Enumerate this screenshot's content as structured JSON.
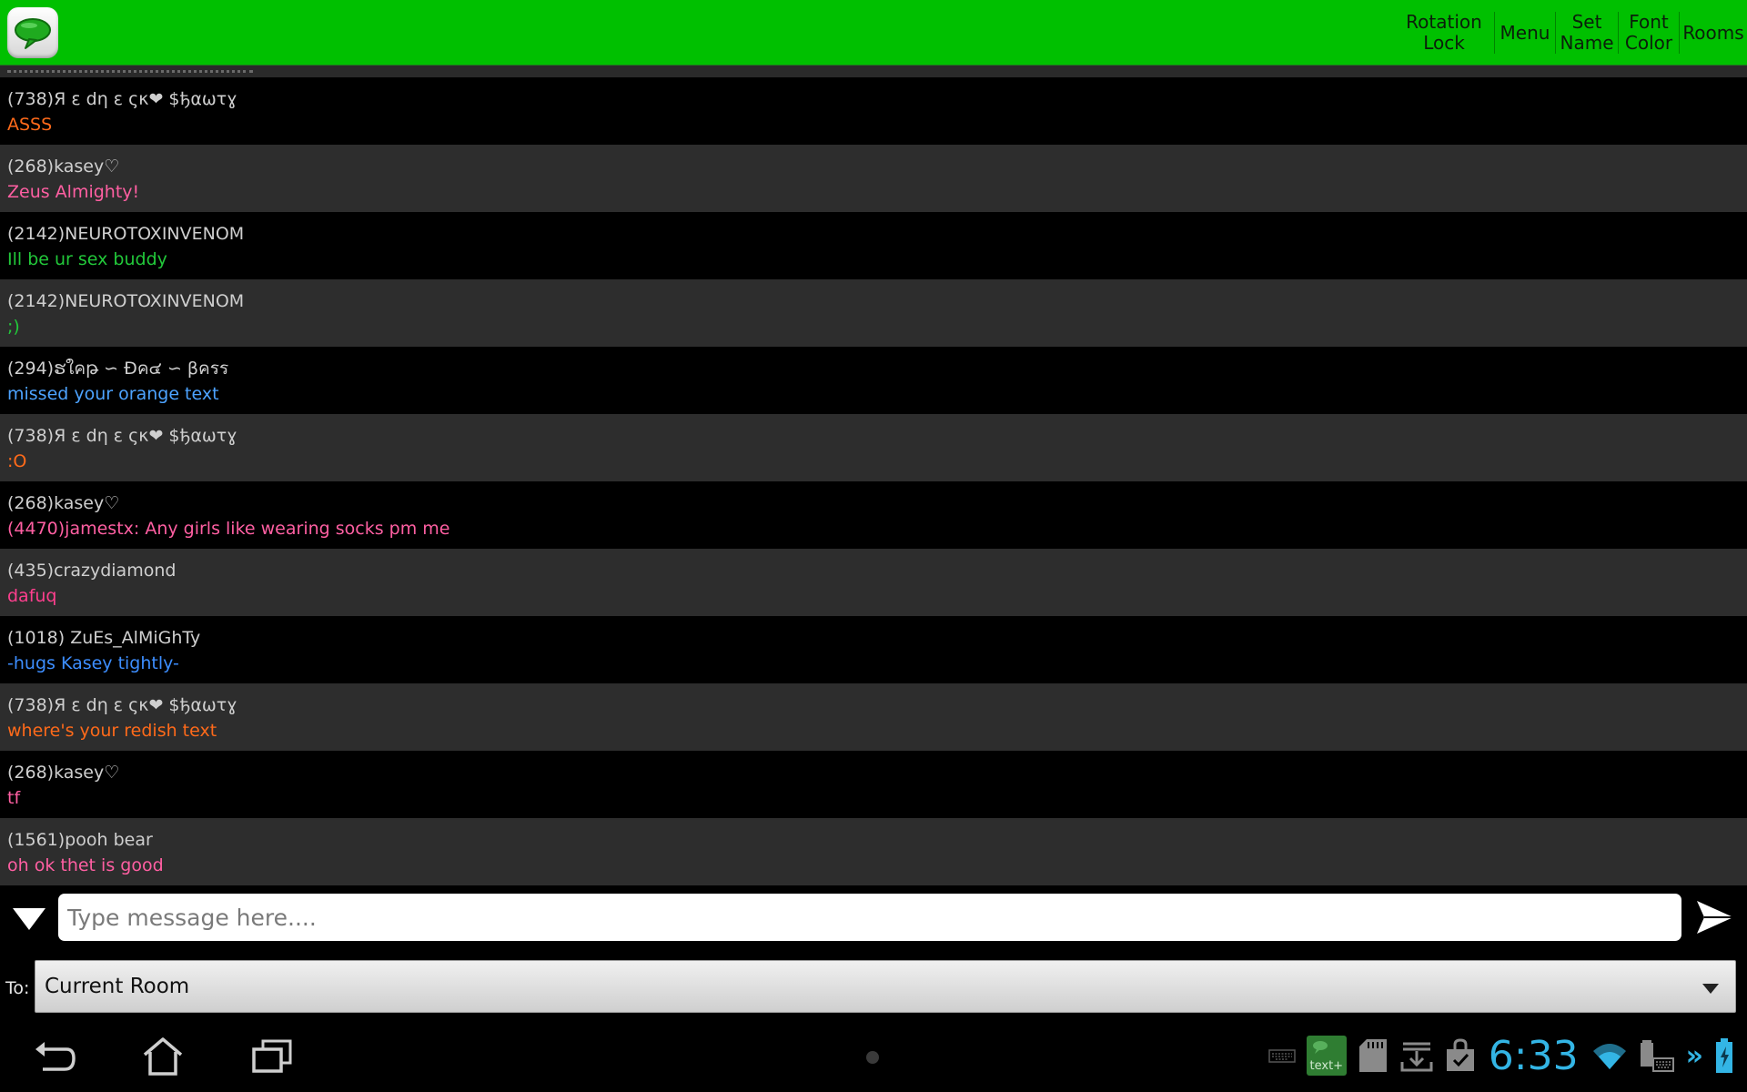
{
  "topbar": {
    "actions": {
      "rotation_lock": "Rotation\nLock",
      "menu": "Menu",
      "set_name": "Set\nName",
      "font_color": "Font\nColor",
      "rooms": "Rooms"
    }
  },
  "messages": [
    {
      "user": "(738)Я ε dη ε ςκ❤ $ђαωτɣ",
      "text": "ASSS",
      "color": "#ff6a1a"
    },
    {
      "user": "(268)kasey♡",
      "text": "Zeus Almighty!",
      "color": "#ff5fa2"
    },
    {
      "user": "(2142)NEUROTOXINVENOM",
      "text": "Ill be ur sex buddy",
      "color": "#22c83a"
    },
    {
      "user": "(2142)NEUROTOXINVENOM",
      "text": ";)",
      "color": "#22c83a"
    },
    {
      "user": "(294)ຮใคթ ∽ Đค๔ ∽ βครร",
      "text": "missed your orange text",
      "color": "#4da3ff"
    },
    {
      "user": "(738)Я ε dη ε ςκ❤ $ђαωτɣ",
      "text": ":O",
      "color": "#ff6a1a"
    },
    {
      "user": "(268)kasey♡",
      "text": "(4470)jamestx: Any girls like wearing socks pm me",
      "color": "#ff5fa2"
    },
    {
      "user": "(435)crazydiamond",
      "text": "dafuq",
      "color": "#ff3f8e"
    },
    {
      "user": "(1018) ZuEs_AlMiGhTy",
      "text": "-hugs Kasey tightly-",
      "color": "#3d8eff"
    },
    {
      "user": "(738)Я ε dη ε ςκ❤ $ђαωτɣ",
      "text": "where's your redish text",
      "color": "#ff6a1a"
    },
    {
      "user": "(268)kasey♡",
      "text": "tf",
      "color": "#ff5fa2"
    },
    {
      "user": "(1561)pooh bear",
      "text": "oh ok thet is good",
      "color": "#ff5fa2"
    }
  ],
  "input": {
    "placeholder": "Type message here...."
  },
  "recipient": {
    "label": "To:",
    "selected": "Current Room"
  },
  "statusbar": {
    "time": "6:33",
    "textplus_label": "text+"
  },
  "icons": {
    "app": "chat-bubble-icon",
    "collapse": "triangle-down-icon",
    "send": "send-arrow-icon",
    "dropdown": "chevron-down-icon",
    "back": "back-icon",
    "home": "home-icon",
    "recent": "recent-apps-icon",
    "keyboard": "keyboard-icon",
    "sd": "sd-card-icon",
    "download": "download-icon",
    "bag": "shopping-bag-check-icon",
    "wifi": "wifi-icon",
    "battery_keyboard": "keyboard-battery-icon",
    "battery": "battery-charging-icon"
  },
  "colors": {
    "topbar": "#00c000",
    "clock": "#33b5e5"
  }
}
